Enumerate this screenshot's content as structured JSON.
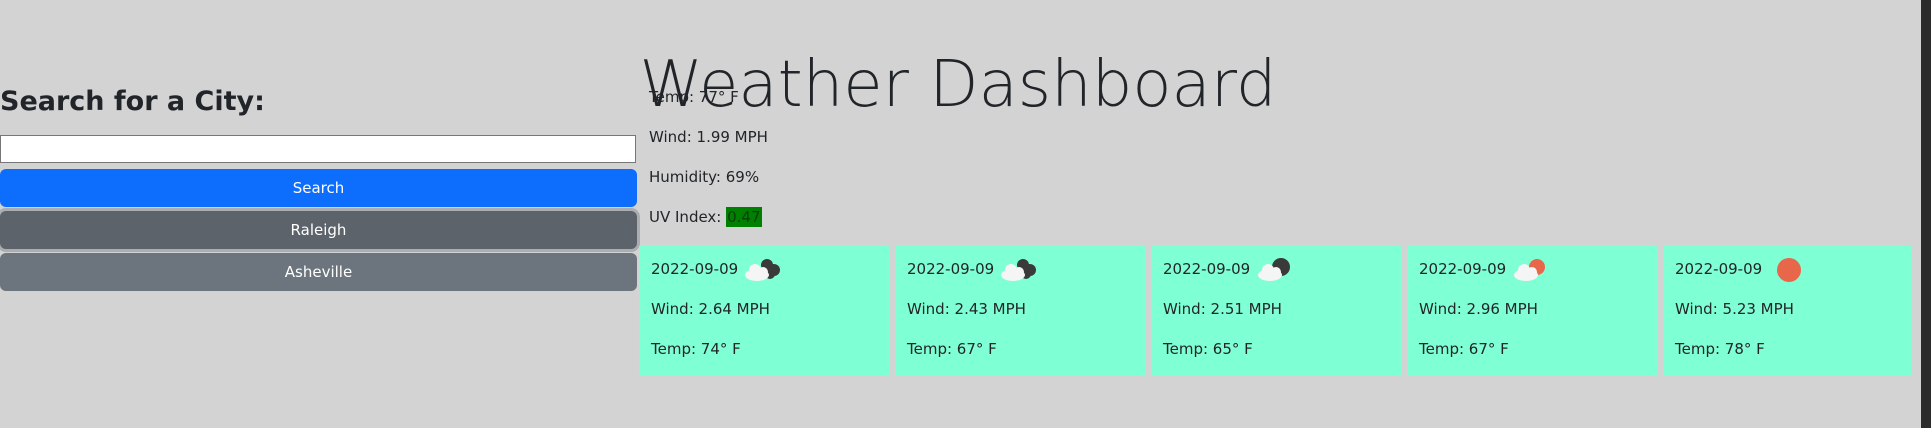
{
  "header": {
    "title": "Weather Dashboard"
  },
  "search": {
    "label": "Search for a City:",
    "input_value": "",
    "placeholder": "",
    "button_label": "Search"
  },
  "history": [
    {
      "label": "Raleigh"
    },
    {
      "label": "Asheville"
    }
  ],
  "current": {
    "temp": "Temp: 77° F",
    "wind": "Wind: 1.99 MPH",
    "humidity": "Humidity: 69%",
    "uv_label": "UV Index: ",
    "uv_value": "0.47",
    "uv_color": "#008000"
  },
  "forecast": [
    {
      "date": "2022-09-09",
      "icon": "broken-clouds-icon",
      "wind": "Wind: 2.64 MPH",
      "temp": "Temp: 74° F"
    },
    {
      "date": "2022-09-09",
      "icon": "broken-clouds-icon",
      "wind": "Wind: 2.43 MPH",
      "temp": "Temp: 67° F"
    },
    {
      "date": "2022-09-09",
      "icon": "overcast-clouds-icon",
      "wind": "Wind: 2.51 MPH",
      "temp": "Temp: 65° F"
    },
    {
      "date": "2022-09-09",
      "icon": "few-clouds-icon",
      "wind": "Wind: 2.96 MPH",
      "temp": "Temp: 67° F"
    },
    {
      "date": "2022-09-09",
      "icon": "clear-sky-icon",
      "wind": "Wind: 5.23 MPH",
      "temp": "Temp: 78° F"
    }
  ],
  "colors": {
    "background": "#d3d3d3",
    "forecast_card": "#7fffd4",
    "search_button": "#0d6efd",
    "history_button": "#6c757d",
    "sun": "#e8664a"
  }
}
